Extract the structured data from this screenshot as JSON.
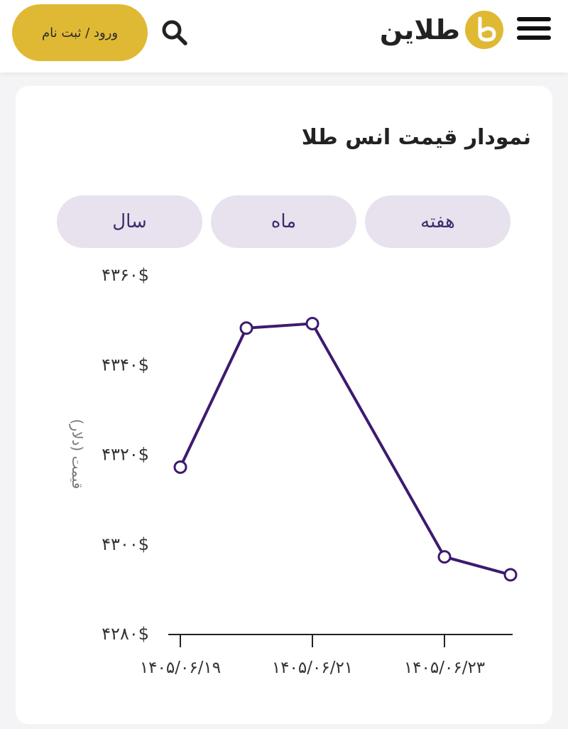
{
  "header": {
    "login_label": "ورود / ثبت نام",
    "logo_text": "طلاین",
    "search_icon": "search-icon",
    "menu_icon": "hamburger-menu-icon",
    "accent_color": "#e0b934"
  },
  "card": {
    "title": "نمودار قیمت انس طلا",
    "tabs": [
      {
        "label": "هفته"
      },
      {
        "label": "ماه"
      },
      {
        "label": "سال"
      }
    ]
  },
  "chart_data": {
    "type": "line",
    "title": "",
    "ylabel": "قیمت (دلار)",
    "xlabel": "",
    "ylim": [
      4280,
      4360
    ],
    "ytick_values": [
      4280,
      4300,
      4320,
      4340,
      4360
    ],
    "ytick_labels": [
      "۴۲۸۰$",
      "۴۳۰۰$",
      "۴۳۲۰$",
      "۴۳۴۰$",
      "۴۳۶۰$"
    ],
    "x_values": [
      0,
      1,
      2,
      4,
      5
    ],
    "xlim": [
      0,
      5
    ],
    "xtick_positions": [
      0,
      2,
      4
    ],
    "xtick_labels": [
      "۱۴۰۵/۰۶/۱۹",
      "۱۴۰۵/۰۶/۲۱",
      "۱۴۰۵/۰۶/۲۳"
    ],
    "series": [
      {
        "values": [
          4317,
          4348,
          4349,
          4297,
          4293
        ],
        "color": "#3d1a6e"
      }
    ],
    "grid": false
  }
}
